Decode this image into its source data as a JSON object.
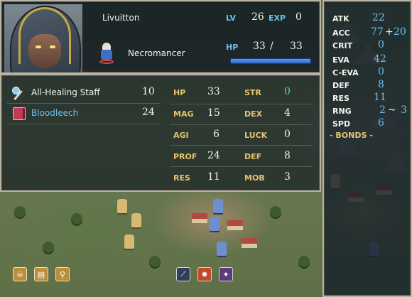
{
  "unit": {
    "name": "Livuitton",
    "class": "Necromancer",
    "level_label": "LV",
    "level": "26",
    "exp_label": "EXP",
    "exp": "0",
    "hp_label": "HP",
    "hp_current": "33",
    "hp_separator": "/",
    "hp_max": "33",
    "hp_fraction": 1.0
  },
  "items": [
    {
      "name": "All-Healing Staff",
      "uses": "10",
      "icon": "staff-icon",
      "color": "#f4f4ec"
    },
    {
      "name": "Bloodleech",
      "uses": "24",
      "icon": "tome-icon",
      "color": "#6ec0ee"
    }
  ],
  "stats": [
    {
      "label": "HP",
      "value": "33"
    },
    {
      "label": "STR",
      "value": "0",
      "color": "#56e078"
    },
    {
      "label": "MAG",
      "value": "15"
    },
    {
      "label": "DEX",
      "value": "4"
    },
    {
      "label": "AGI",
      "value": "6"
    },
    {
      "label": "LUCK",
      "value": "0"
    },
    {
      "label": "PROF",
      "value": "24"
    },
    {
      "label": "DEF",
      "value": "8"
    },
    {
      "label": "RES",
      "value": "11"
    },
    {
      "label": "MOB",
      "value": "3"
    }
  ],
  "combat": {
    "atk_label": "ATK",
    "atk": "22",
    "acc_label": "ACC",
    "acc": "77",
    "acc_plus": "+",
    "acc_bonus": "20",
    "crit_label": "CRIT",
    "crit": "0",
    "eva_label": "EVA",
    "eva": "42",
    "ceva_label": "C-EVA",
    "ceva": "0",
    "def_label": "DEF",
    "def": "8",
    "res_label": "RES",
    "res": "11",
    "rng_label": "RNG",
    "rng_min": "2",
    "rng_sep": "~",
    "rng_max": "3",
    "spd_label": "SPD",
    "spd": "6",
    "bonds_label": "- BONDS -"
  },
  "bottom_icons": {
    "left": [
      "skull-icon",
      "book-icon",
      "staff-icon"
    ],
    "right": [
      "staff-skill-icon",
      "explosion-skill-icon",
      "sparkle-skill-icon"
    ]
  },
  "colors": {
    "label_blue": "#6ec0ee",
    "value_white": "#f4f4ec",
    "buff_green": "#56e078",
    "hp_bar_blue": "#2f66c9",
    "panel_border": "#b9b4a2"
  }
}
